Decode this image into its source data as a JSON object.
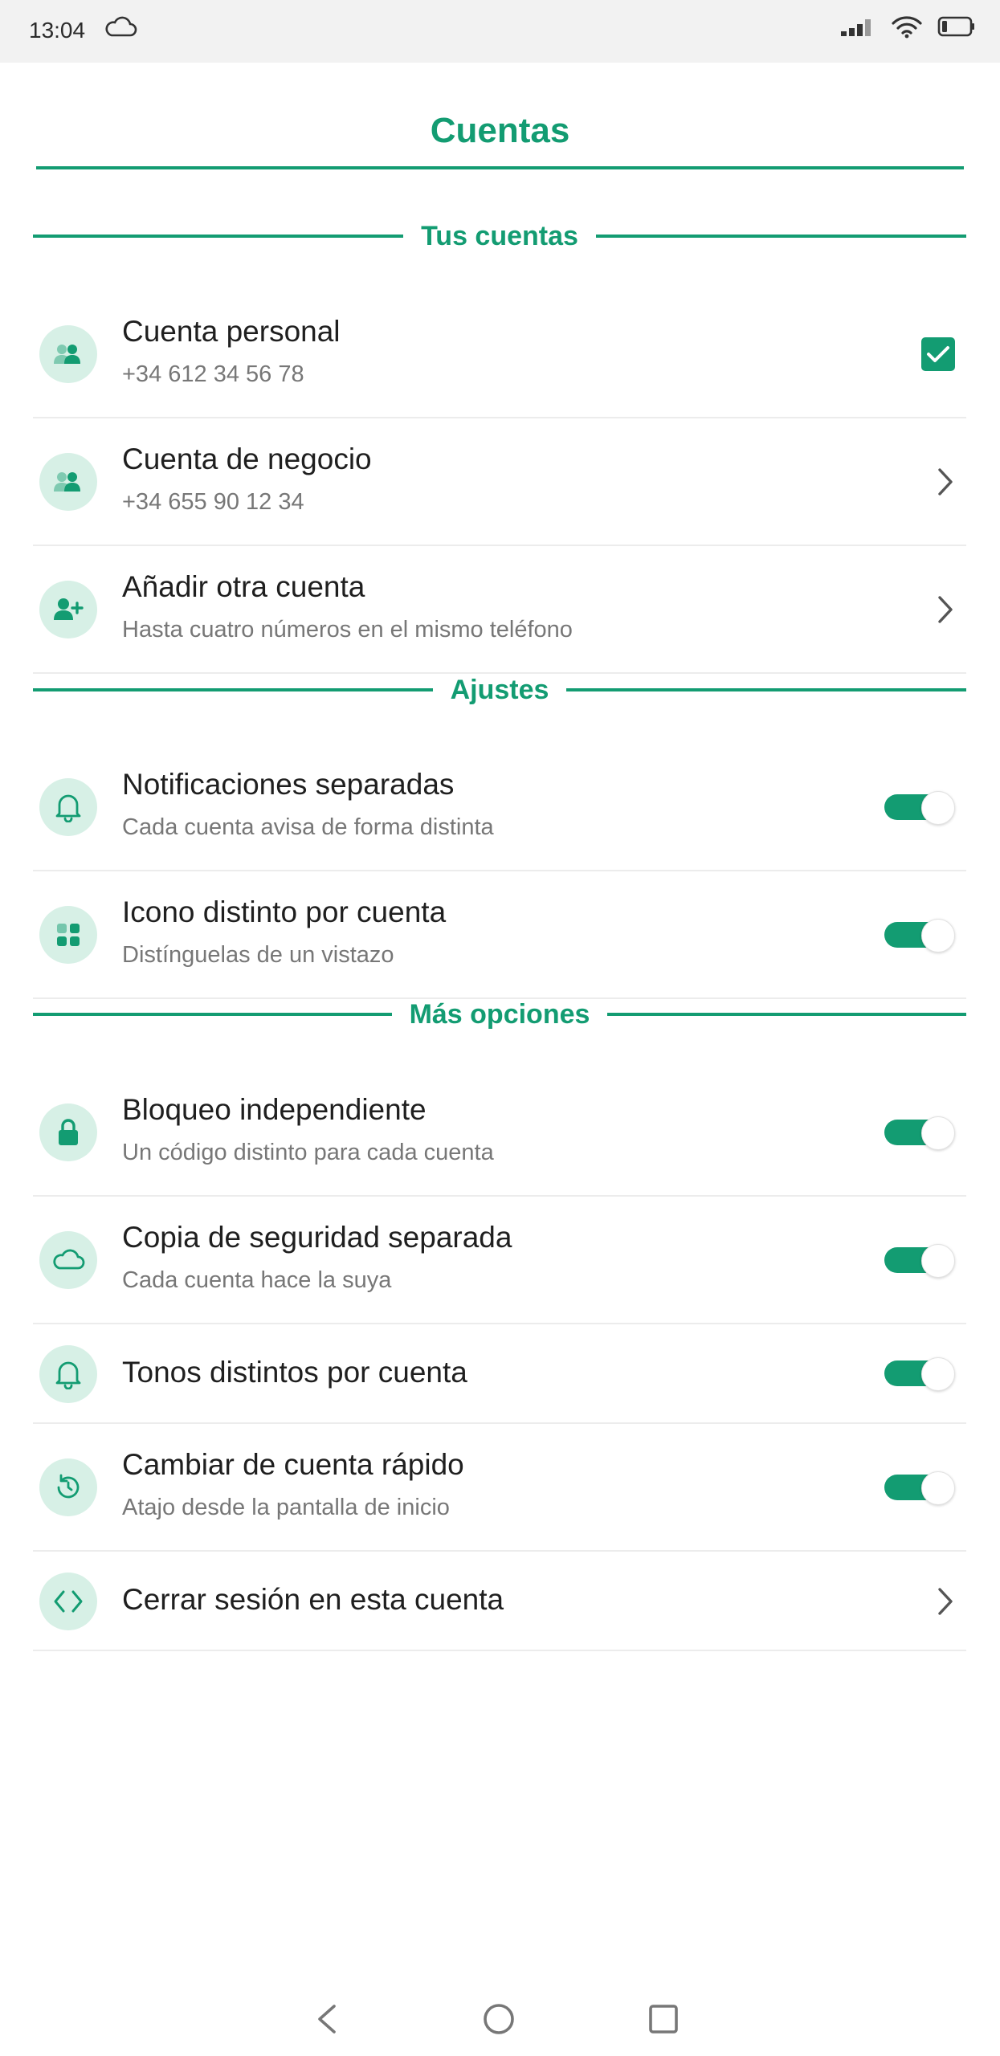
{
  "status_bar": {
    "time": "13:04"
  },
  "header": {
    "title": "Cuentas"
  },
  "sections": {
    "accounts": "Tus cuentas",
    "settings": "Ajustes",
    "more": "Más opciones"
  },
  "accounts": [
    {
      "title": "Cuenta personal",
      "subtitle": "+34 612 34 56 78",
      "selected": true
    },
    {
      "title": "Cuenta de negocio",
      "subtitle": "+34 655 90 12 34"
    },
    {
      "title": "Añadir otra cuenta",
      "subtitle": "Hasta cuatro números en el mismo teléfono"
    }
  ],
  "settings": [
    {
      "title": "Notificaciones separadas",
      "subtitle": "Cada cuenta avisa de forma distinta",
      "enabled": true
    },
    {
      "title": "Icono distinto por cuenta",
      "subtitle": "Distínguelas de un vistazo",
      "enabled": true
    }
  ],
  "more": [
    {
      "title": "Bloqueo independiente",
      "subtitle": "Un código distinto para cada cuenta",
      "enabled": true
    },
    {
      "title": "Copia de seguridad separada",
      "subtitle": "Cada cuenta hace la suya",
      "enabled": true
    },
    {
      "title": "Tonos distintos por cuenta",
      "enabled": true
    },
    {
      "title": "Cambiar de cuenta rápido",
      "subtitle": "Atajo desde la pantalla de inicio",
      "enabled": true
    },
    {
      "title": "Cerrar sesión en esta cuenta"
    }
  ],
  "colors": {
    "accent": "#139c72",
    "icon_bg": "#d7f0e6",
    "divider": "#ececec",
    "status_bg": "#f2f2f2"
  }
}
